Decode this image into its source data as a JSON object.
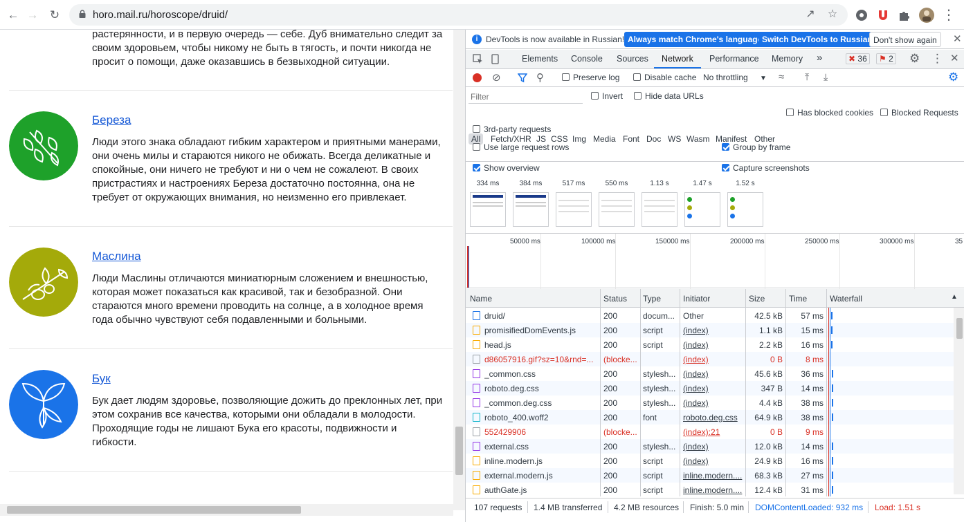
{
  "browser": {
    "url": "horo.mail.ru/horoscope/druid/"
  },
  "page": {
    "top_text": "растерянности, и в первую очередь — себе. Дуб внимательно следит за своим здоровьем, чтобы никому не быть в тягость, и почти никогда не просит о помощи, даже оказавшись в безвыходной ситуации.",
    "top_lines": [
      "растерянности, и в первую очередь — себе. Дуб внимательно следит за",
      "своим здоровьем, чтобы никому не быть в тягость, и почти никогда не",
      "просит о помощи, даже оказавшись в безвыходной ситуации."
    ],
    "entries": [
      {
        "title": "Береза",
        "color": "#1ea12a",
        "lines": [
          "Люди этого знака обладают гибким характером и приятными манерами,",
          "они очень милы и стараются никого не обижать. Всегда деликатные и",
          "спокойные, они ничего не требуют и ни о чем не сожалеют. В своих",
          "пристрастиях и настроениях Береза достаточно постоянна, она не",
          "требует от окружающих внимания, но неизменно его привлекает."
        ]
      },
      {
        "title": "Маслина",
        "color": "#a4aa0a",
        "lines": [
          "Люди Маслины отличаются миниатюрным сложением и внешностью,",
          "которая может показаться как красивой, так и безобразной. Они",
          "стараются много времени проводить на солнце, а в холодное время",
          "года обычно чувствуют себя подавленными и больными."
        ]
      },
      {
        "title": "Бук",
        "color": "#1a73e8",
        "lines": [
          "Бук дает людям здоровье, позволяющие дожить до преклонных лет, при",
          "этом сохранив все качества, которыми они обладали в молодости.",
          "Проходящие годы не лишают Бука его красоты, подвижности и",
          "гибкости."
        ]
      }
    ]
  },
  "devtools": {
    "infobar": {
      "message": "DevTools is now available in Russian!",
      "btn_match": "Always match Chrome's language",
      "btn_switch": "Switch DevTools to Russian",
      "btn_dismiss": "Don't show again"
    },
    "tabs": [
      "Elements",
      "Console",
      "Sources",
      "Network",
      "Performance",
      "Memory"
    ],
    "tabs_more": "»",
    "error_count": "36",
    "warning_count": "2",
    "toolbar": {
      "preserve_log": "Preserve log",
      "disable_cache": "Disable cache",
      "throttling": "No throttling"
    },
    "filter": {
      "placeholder": "Filter",
      "invert": "Invert",
      "hide_data_urls": "Hide data URLs",
      "types": [
        "All",
        "Fetch/XHR",
        "JS",
        "CSS",
        "Img",
        "Media",
        "Font",
        "Doc",
        "WS",
        "Wasm",
        "Manifest",
        "Other"
      ],
      "has_blocked_cookies": "Has blocked cookies",
      "blocked_requests": "Blocked Requests",
      "third_party": "3rd-party requests"
    },
    "options": {
      "large_rows": "Use large request rows",
      "group_by_frame": "Group by frame",
      "show_overview": "Show overview",
      "capture_screenshots": "Capture screenshots"
    },
    "screenshots": [
      "334 ms",
      "384 ms",
      "517 ms",
      "550 ms",
      "1.13 s",
      "1.47 s",
      "1.52 s"
    ],
    "overview_ticks": [
      "50000 ms",
      "100000 ms",
      "150000 ms",
      "200000 ms",
      "250000 ms",
      "300000 ms",
      "35"
    ],
    "columns": [
      "Name",
      "Status",
      "Type",
      "Initiator",
      "Size",
      "Time",
      "Waterfall"
    ],
    "requests": [
      {
        "name": "druid/",
        "status": "200",
        "type": "docum...",
        "initiator": "Other",
        "size": "42.5 kB",
        "time": "57 ms",
        "kind": "doc",
        "error": false
      },
      {
        "name": "promisifiedDomEvents.js",
        "status": "200",
        "type": "script",
        "initiator": "(index)",
        "size": "1.1 kB",
        "time": "15 ms",
        "kind": "js",
        "error": false
      },
      {
        "name": "head.js",
        "status": "200",
        "type": "script",
        "initiator": "(index)",
        "size": "2.2 kB",
        "time": "16 ms",
        "kind": "js",
        "error": false
      },
      {
        "name": "d86057916.gif?sz=10&rnd=...",
        "status": "(blocke...",
        "type": "",
        "initiator": "(index)",
        "size": "0 B",
        "time": "8 ms",
        "kind": "other",
        "error": true
      },
      {
        "name": "_common.css",
        "status": "200",
        "type": "stylesh...",
        "initiator": "(index)",
        "size": "45.6 kB",
        "time": "36 ms",
        "kind": "css",
        "error": false
      },
      {
        "name": "roboto.deg.css",
        "status": "200",
        "type": "stylesh...",
        "initiator": "(index)",
        "size": "347 B",
        "time": "14 ms",
        "kind": "css",
        "error": false
      },
      {
        "name": "_common.deg.css",
        "status": "200",
        "type": "stylesh...",
        "initiator": "(index)",
        "size": "4.4 kB",
        "time": "38 ms",
        "kind": "css",
        "error": false
      },
      {
        "name": "roboto_400.woff2",
        "status": "200",
        "type": "font",
        "initiator": "roboto.deg.css",
        "size": "64.9 kB",
        "time": "38 ms",
        "kind": "font",
        "error": false
      },
      {
        "name": "552429906",
        "status": "(blocke...",
        "type": "",
        "initiator": "(index):21",
        "size": "0 B",
        "time": "9 ms",
        "kind": "other",
        "error": true
      },
      {
        "name": "external.css",
        "status": "200",
        "type": "stylesh...",
        "initiator": "(index)",
        "size": "12.0 kB",
        "time": "14 ms",
        "kind": "css",
        "error": false
      },
      {
        "name": "inline.modern.js",
        "status": "200",
        "type": "script",
        "initiator": "(index)",
        "size": "24.9 kB",
        "time": "16 ms",
        "kind": "js",
        "error": false
      },
      {
        "name": "external.modern.js",
        "status": "200",
        "type": "script",
        "initiator": "inline.modern....",
        "size": "68.3 kB",
        "time": "27 ms",
        "kind": "js",
        "error": false
      },
      {
        "name": "authGate.js",
        "status": "200",
        "type": "script",
        "initiator": "inline.modern....",
        "size": "12.4 kB",
        "time": "31 ms",
        "kind": "js",
        "error": false
      }
    ],
    "status_bar": {
      "requests": "107 requests",
      "transferred": "1.4 MB transferred",
      "resources": "4.2 MB resources",
      "finish": "Finish: 5.0 min",
      "dom_loaded": "DOMContentLoaded: 932 ms",
      "load": "Load: 1.51 s"
    },
    "colors": {
      "accent": "#1a73e8",
      "error": "#d93025"
    }
  }
}
